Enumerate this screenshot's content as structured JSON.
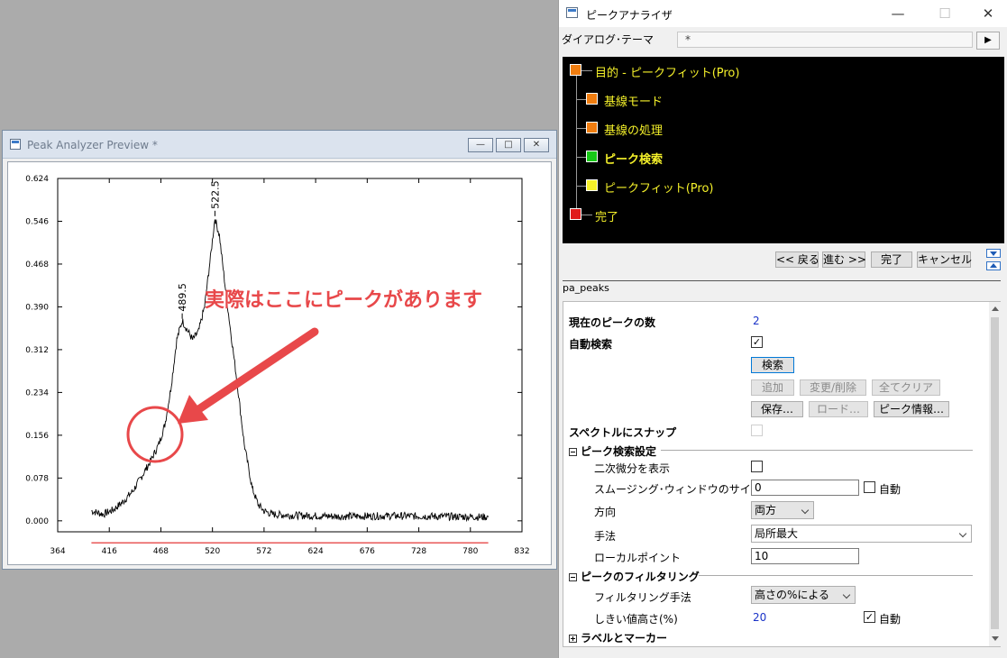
{
  "preview": {
    "title": "Peak Analyzer Preview *",
    "min_label": "—",
    "max_label": "□",
    "close_label": "✕"
  },
  "annotation": {
    "text": "実際はここにピークがあります",
    "color": "#e8484a"
  },
  "chart_data": {
    "type": "line",
    "x_ticks": [
      "364",
      "416",
      "468",
      "520",
      "572",
      "624",
      "676",
      "728",
      "780",
      "832"
    ],
    "y_ticks": [
      "0.000",
      "0.078",
      "0.156",
      "0.234",
      "0.312",
      "0.390",
      "0.468",
      "0.546",
      "0.624"
    ],
    "xlim": [
      364,
      832
    ],
    "ylim": [
      -0.02,
      0.624
    ],
    "baseline_y": -0.04,
    "baseline_color": "#e02020",
    "peaks": [
      {
        "label": "489.5",
        "x": 489.5,
        "y": 0.365
      },
      {
        "label": "522.5",
        "x": 522.5,
        "y": 0.552
      }
    ],
    "series": [
      {
        "x": [
          398,
          410,
          420,
          430,
          440,
          450,
          458,
          466,
          472,
          478,
          484,
          489.5,
          494,
          500,
          506,
          512,
          518,
          522.5,
          527,
          532,
          538,
          545,
          552,
          560,
          566,
          572,
          580,
          600,
          650,
          700,
          750,
          798
        ],
        "values": [
          0.018,
          0.012,
          0.02,
          0.035,
          0.055,
          0.085,
          0.11,
          0.14,
          0.175,
          0.24,
          0.33,
          0.365,
          0.35,
          0.33,
          0.345,
          0.39,
          0.48,
          0.552,
          0.52,
          0.44,
          0.35,
          0.25,
          0.14,
          0.06,
          0.03,
          0.018,
          0.012,
          0.01,
          0.008,
          0.009,
          0.008,
          0.007
        ]
      }
    ]
  },
  "dialog": {
    "title": "ピークアナライザ",
    "min": "—",
    "max": "☐",
    "close": "✕",
    "theme_label": "ダイアログ･テーマ",
    "theme_value": "*",
    "theme_arrow": "▶",
    "flow": [
      {
        "label": "目的 - ピークフィット(Pro)",
        "color": "#f07d10"
      },
      {
        "label": "基線モード",
        "color": "#f07d10"
      },
      {
        "label": "基線の処理",
        "color": "#f07d10"
      },
      {
        "label": "ピーク検索",
        "color": "#18c818"
      },
      {
        "label": "ピークフィット(Pro)",
        "color": "#f6f02a"
      },
      {
        "label": "完了",
        "color": "#e01a1a"
      }
    ],
    "nav": {
      "back": "<< 戻る",
      "next": "進む >>",
      "finish": "完了",
      "cancel": "キャンセル"
    },
    "page_label": "pa_peaks",
    "props": {
      "peak_count_label": "現在のピークの数",
      "peak_count_value": "2",
      "auto_find_label": "自動検索",
      "auto_find_check": "✓",
      "find_btn": "検索",
      "add_btn": "追加",
      "modify_btn": "変更/削除",
      "clear_btn": "全てクリア",
      "save_btn": "保存…",
      "load_btn": "ロード…",
      "info_btn": "ピーク情報…",
      "snap_label": "スペクトルにスナップ",
      "section_find": "ピーク検索設定",
      "second_deriv_label": "二次微分を表示",
      "smooth_label": "スムージング･ウィンドウのサイズ",
      "smooth_value": "0",
      "auto_label": "自動",
      "direction_label": "方向",
      "direction_value": "両方",
      "method_label": "手法",
      "method_value": "局所最大",
      "local_points_label": "ローカルポイント",
      "local_points_value": "10",
      "section_filter": "ピークのフィルタリング",
      "filter_method_label": "フィルタリング手法",
      "filter_method_value": "高さの%による",
      "threshold_label": "しきい値高さ(%)",
      "threshold_value": "20",
      "threshold_auto_check": "✓",
      "section_labels": "ラベルとマーカー"
    }
  }
}
